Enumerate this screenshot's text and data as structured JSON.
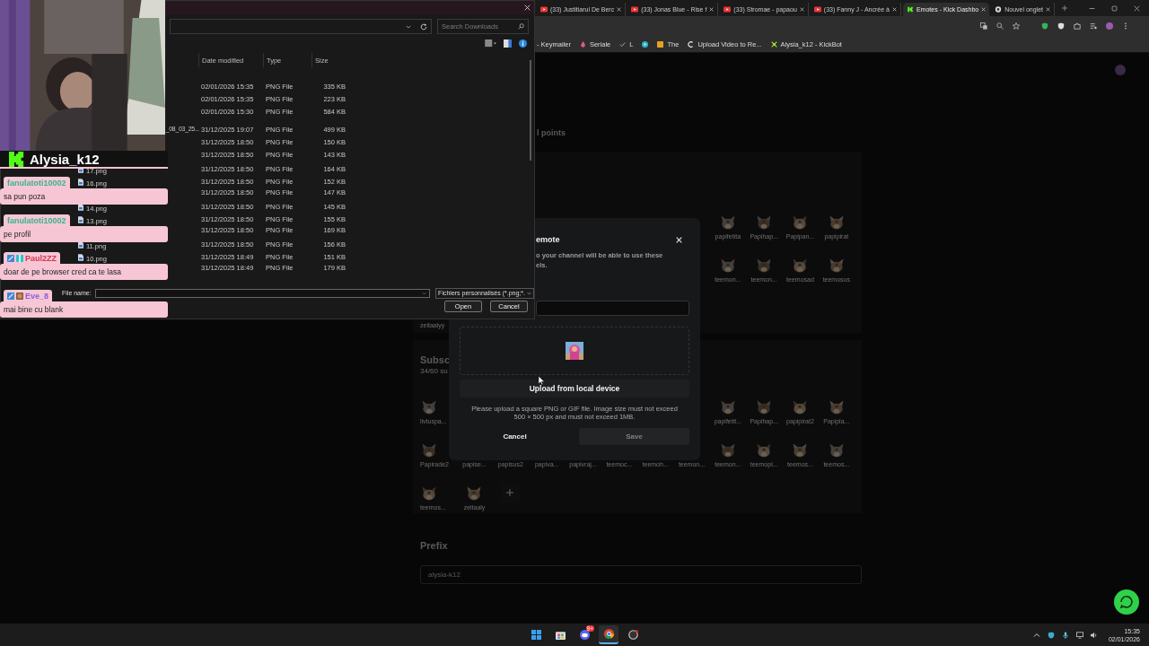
{
  "browser": {
    "tabs": [
      {
        "title": "(33) Justitiarul De Berc",
        "kind": "video",
        "selected": false
      },
      {
        "title": "(33) Jonas Blue - Rise f",
        "kind": "video",
        "selected": false
      },
      {
        "title": "(33) Stromae - papaou",
        "kind": "video",
        "selected": false
      },
      {
        "title": "(33) Fanny J - Ancrée à",
        "kind": "video",
        "selected": false
      },
      {
        "title": "Emotes - Kick Dashbo",
        "kind": "kick",
        "selected": true
      },
      {
        "title": "Nouvel onglet",
        "kind": "newtab",
        "selected": false
      }
    ],
    "bookmarks": [
      {
        "label": "- Keymailer",
        "kind": "text"
      },
      {
        "label": "Seriale",
        "kind": "flame"
      },
      {
        "label": "L",
        "kind": "check"
      },
      {
        "kind": "play"
      },
      {
        "label": "The",
        "kind": "square"
      },
      {
        "label": "Upload Video to Re...",
        "kind": "c"
      },
      {
        "label": "Alysia_k12 - KickBot",
        "kind": "bot"
      }
    ]
  },
  "page": {
    "points_heading": "l points",
    "points_rows": [
      [
        null,
        null,
        null,
        null,
        null,
        null,
        null,
        null,
        {
          "name": "papifetita"
        },
        {
          "name": "Papihap..."
        },
        {
          "name": "Papipan..."
        },
        {
          "name": "papipirat"
        }
      ],
      [
        null,
        null,
        null,
        null,
        null,
        null,
        null,
        null,
        {
          "name": "teemon..."
        },
        {
          "name": "teemon..."
        },
        {
          "name": "teemosad"
        },
        {
          "name": "teemosus"
        }
      ]
    ],
    "points_name_below": "zeitaalyy",
    "subs_heading": "Subsc",
    "subs_count": "34/60 su",
    "subs_rows": [
      [
        {
          "name": "livtuspa..."
        },
        null,
        null,
        null,
        null,
        null,
        null,
        null,
        {
          "name": "papifetit..."
        },
        {
          "name": "Papihap..."
        },
        {
          "name": "papipirat2"
        },
        {
          "name": "Papipla..."
        }
      ],
      [
        {
          "name": "Papirade2"
        },
        "papise...",
        "papisus2",
        "papiva...",
        "papivraj...",
        {
          "name": "teemoc..."
        },
        {
          "name": "teemoh..."
        },
        {
          "name": "teemon..."
        },
        {
          "name": "teemon..."
        },
        {
          "name": "teemopl..."
        },
        {
          "name": "teemos..."
        },
        {
          "name": "teemos..."
        }
      ],
      [
        {
          "name": "teemos..."
        },
        {
          "name": "zeitaaly"
        }
      ]
    ],
    "prefix_heading": "Prefix",
    "prefix_value": "alysia-k12"
  },
  "modal": {
    "title": "emote",
    "description": [
      "o your channel will be able to use these",
      "els."
    ],
    "upload_button": "Upload from local device",
    "help": "Please upload a square PNG or GIF file. Image size must not exceed 500 × 500 px and must not exceed 1MB.",
    "buttons": [
      {
        "label": "Cancel",
        "disabled": false
      },
      {
        "label": "Save",
        "disabled": true
      }
    ]
  },
  "file_dialog": {
    "search": {
      "placeholder": "Search Downloads"
    },
    "columns": [
      "Date modified",
      "Type",
      "Size"
    ],
    "groups": [
      {
        "rows": [
          {
            "date": "02/01/2026 15:35",
            "type": "PNG File",
            "size": "335 KB"
          },
          {
            "date": "02/01/2026 15:35",
            "type": "PNG File",
            "size": "223 KB"
          },
          {
            "date": "02/01/2026 15:30",
            "type": "PNG File",
            "size": "584 KB"
          }
        ]
      },
      {
        "rows": [
          {
            "name": "_08_03_25...",
            "kind": "cut",
            "date": "31/12/2025 19:07",
            "type": "PNG File",
            "size": "499 KB"
          },
          {
            "date": "31/12/2025 18:50",
            "type": "PNG File",
            "size": "150 KB"
          },
          {
            "date": "31/12/2025 18:50",
            "type": "PNG File",
            "size": "143 KB"
          },
          {
            "name": "17.png",
            "date": "31/12/2025 18:50",
            "type": "PNG File",
            "size": "164 KB"
          },
          {
            "name": "16.png",
            "date": "31/12/2025 18:50",
            "type": "PNG File",
            "size": "152 KB"
          },
          {
            "date": "31/12/2025 18:50",
            "type": "PNG File",
            "size": "147 KB"
          },
          {
            "name": "14.png",
            "date": "31/12/2025 18:50",
            "type": "PNG File",
            "size": "145 KB"
          },
          {
            "name": "13.png",
            "date": "31/12/2025 18:50",
            "type": "PNG File",
            "size": "155 KB"
          },
          {
            "date": "31/12/2025 18:50",
            "type": "PNG File",
            "size": "169 KB"
          },
          {
            "name": "11.png",
            "date": "31/12/2025 18:50",
            "type": "PNG File",
            "size": "156 KB"
          },
          {
            "name": "10.png",
            "date": "31/12/2025 18:49",
            "type": "PNG File",
            "size": "151 KB"
          },
          {
            "date": "31/12/2025 18:49",
            "type": "PNG File",
            "size": "179 KB"
          }
        ]
      }
    ],
    "file_name_label": "File name:",
    "file_type": "Fichiers personnalisés (*.png;*.",
    "buttons": [
      "Open",
      "Cancel"
    ]
  },
  "stream": {
    "channel": "Alysia_k12",
    "chat": [
      {
        "user": "fanulatoti10002",
        "color": "#33b58f",
        "message": "sa pun poza"
      },
      {
        "user": "fanulatoti10002",
        "color": "#33b58f",
        "message": "pe profil"
      },
      {
        "user": "Paul2ZZ",
        "color": "#d23552",
        "badges": [
          {
            "kind": "mod"
          },
          {
            "kind": "gift"
          }
        ],
        "message": "doar de pe browser cred ca te lasa"
      },
      {
        "user": "Eve_8",
        "color": "#8b5fd6",
        "badges": [
          {
            "kind": "mod"
          },
          {
            "kind": "box"
          }
        ],
        "message": "mai bine cu blank"
      }
    ]
  },
  "taskbar": {
    "apps": [
      {
        "kind": "start",
        "selected": false
      },
      {
        "kind": "store",
        "selected": false
      },
      {
        "kind": "discord",
        "selected": false,
        "badge": "9+"
      },
      {
        "kind": "chrome",
        "selected": true
      },
      {
        "kind": "obs",
        "selected": false
      }
    ],
    "time": "15:35",
    "date": "02/01/2026"
  }
}
